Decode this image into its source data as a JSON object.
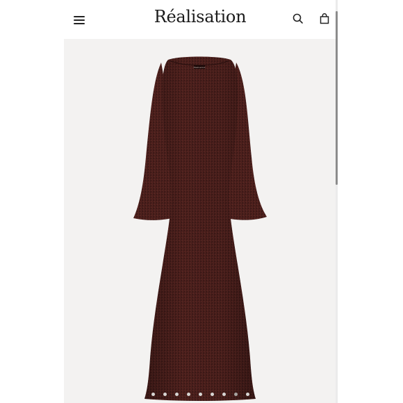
{
  "header": {
    "brand": "Réalisation",
    "menu_icon": "hamburger-menu-icon",
    "search_icon": "search-icon",
    "cart_icon": "shopping-bag-icon"
  },
  "product": {
    "image_label": "Réalisation",
    "colors": {
      "dress": "#4a1f1c",
      "background": "#f3f2f1"
    }
  },
  "gallery": {
    "slide_count": 9,
    "active_index": 7
  }
}
